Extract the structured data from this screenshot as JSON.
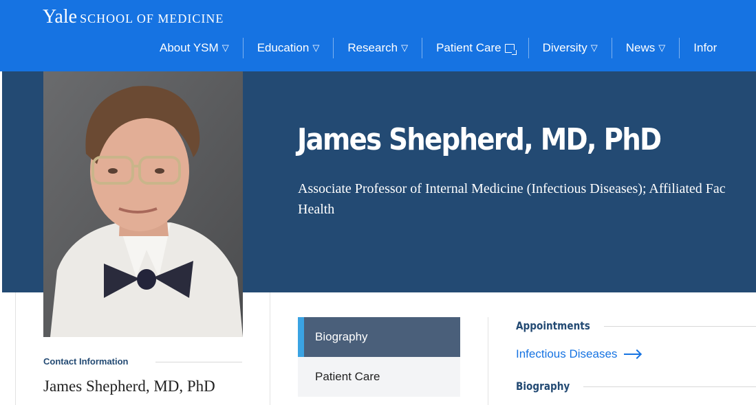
{
  "header": {
    "brand_yale": "Yale",
    "brand_school": "SCHOOL OF MEDICINE",
    "nav": [
      {
        "label": "About YSM",
        "icon": "caret-down-icon"
      },
      {
        "label": "Education",
        "icon": "caret-down-icon"
      },
      {
        "label": "Research",
        "icon": "caret-down-icon"
      },
      {
        "label": "Patient Care",
        "icon": "external-link-icon"
      },
      {
        "label": "Diversity",
        "icon": "caret-down-icon"
      },
      {
        "label": "News",
        "icon": "caret-down-icon"
      },
      {
        "label": "Infor",
        "icon": ""
      }
    ],
    "caret_glyph": "▽"
  },
  "profile": {
    "name": "James Shepherd, MD, PhD",
    "title_line1": "Associate Professor of Internal Medicine (Infectious Diseases); Affiliated Fac",
    "title_line2": "Health"
  },
  "contact": {
    "heading": "Contact Information",
    "name": "James Shepherd, MD, PhD"
  },
  "side_menu": [
    {
      "label": "Biography",
      "active": true
    },
    {
      "label": "Patient Care",
      "active": false
    }
  ],
  "main": {
    "appointments_heading": "Appointments",
    "appointment_link": "Infectious Diseases",
    "biography_heading": "Biography"
  },
  "colors": {
    "brand_blue": "#1673e2",
    "hero_navy": "#234a73",
    "active_menu": "#4a5f7a",
    "active_accent": "#3aa3e3"
  }
}
